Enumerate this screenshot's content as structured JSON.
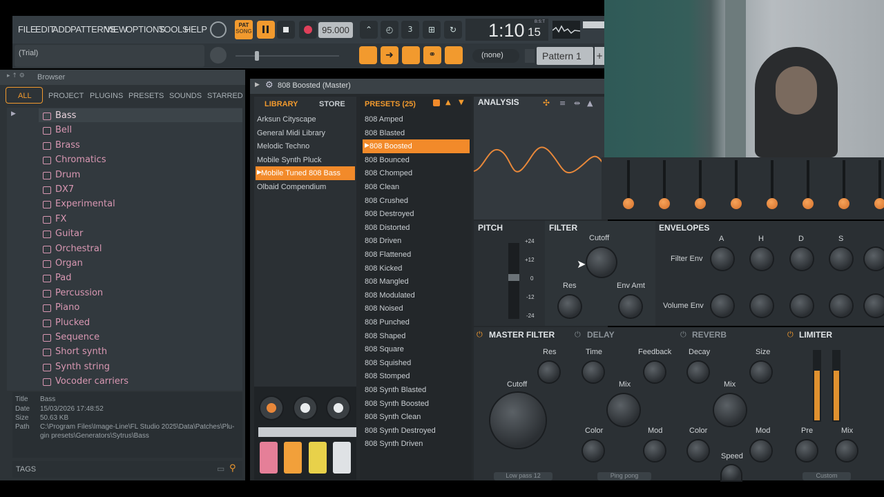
{
  "menu": [
    "FILE",
    "EDIT",
    "ADD",
    "PATTERNS",
    "VIEW",
    "OPTIONS",
    "TOOLS",
    "HELP"
  ],
  "transport": {
    "pat_label": "PAT",
    "song_label": "SONG",
    "tempo": "95.000",
    "time_main": "1:10",
    "time_sub": "15",
    "time_unit": "B:S:T"
  },
  "hint": "(Trial)",
  "pattern": {
    "none_label": "(none)",
    "name": "Pattern 1"
  },
  "browser": {
    "title": "Browser",
    "tabs": [
      "ALL",
      "PROJECT",
      "PLUGINS",
      "PRESETS",
      "SOUNDS",
      "STARRED"
    ],
    "items": [
      "Bass",
      "Bell",
      "Brass",
      "Chromatics",
      "Drum",
      "DX7",
      "Experimental",
      "FX",
      "Guitar",
      "Orchestral",
      "Organ",
      "Pad",
      "Percussion",
      "Piano",
      "Plucked",
      "Sequence",
      "Short synth",
      "Synth string",
      "Vocoder carriers"
    ],
    "info": {
      "title_k": "Title",
      "title_v": "Bass",
      "date_k": "Date",
      "date_v": "15/03/2026 17:48:52",
      "size_k": "Size",
      "size_v": "50.63 KB",
      "path_k": "Path",
      "path_v1": "C:\\Program Files\\Image-Line\\FL Studio 2025\\Data\\Patches\\Plu-",
      "path_v2": "gin presets\\Generators\\Sytrus\\Bass"
    },
    "tags": "TAGS"
  },
  "plugin": {
    "title": "808 Boosted (Master)",
    "library_tab": "LIBRARY",
    "store_tab": "STORE",
    "presets_tab": "PRESETS (25)",
    "libraries": [
      "Arksun Cityscape",
      "General Midi Library",
      "Melodic Techno",
      "Mobile Synth Pluck",
      "Mobile Tuned 808 Bass",
      "Olbaid Compendium"
    ],
    "presets": [
      "808 Amped",
      "808 Blasted",
      "808 Boosted",
      "808 Bounced",
      "808 Chomped",
      "808 Clean",
      "808 Crushed",
      "808 Destroyed",
      "808 Distorted",
      "808 Driven",
      "808 Flattened",
      "808 Kicked",
      "808 Mangled",
      "808 Modulated",
      "808 Noised",
      "808 Punched",
      "808 Shaped",
      "808 Square",
      "808 Squished",
      "808 Stomped",
      "808 Synth Blasted",
      "808 Synth Boosted",
      "808 Synth Clean",
      "808 Synth Destroyed",
      "808 Synth Driven"
    ],
    "analysis": "ANALYSIS",
    "pitch": "PITCH",
    "pitch_ticks": [
      "+24",
      "+12",
      "0",
      "-12",
      "-24"
    ],
    "filter": "FILTER",
    "cutoff": "Cutoff",
    "res": "Res",
    "env_amt": "Env Amt",
    "envelopes": "ENVELOPES",
    "env_cols": [
      "A",
      "H",
      "D",
      "S"
    ],
    "filter_env": "Filter Env",
    "volume_env": "Volume Env",
    "master_filter": "MASTER FILTER",
    "mf_res": "Res",
    "mf_cutoff": "Cutoff",
    "mf_mode": "Low pass 12",
    "delay": "DELAY",
    "d_time": "Time",
    "d_feedback": "Feedback",
    "d_mix": "Mix",
    "d_color": "Color",
    "d_mod": "Mod",
    "d_mode": "Ping pong",
    "reverb": "REVERB",
    "r_decay": "Decay",
    "r_size": "Size",
    "r_mix": "Mix",
    "r_color": "Color",
    "r_mod": "Mod",
    "r_speed": "Speed",
    "limiter": "LIMITER",
    "l_pre": "Pre",
    "l_mix": "Mix",
    "l_mode": "Custom"
  },
  "colors": {
    "accent": "#f28a2a",
    "pink": "#d897b2",
    "panel": "#25292c"
  }
}
